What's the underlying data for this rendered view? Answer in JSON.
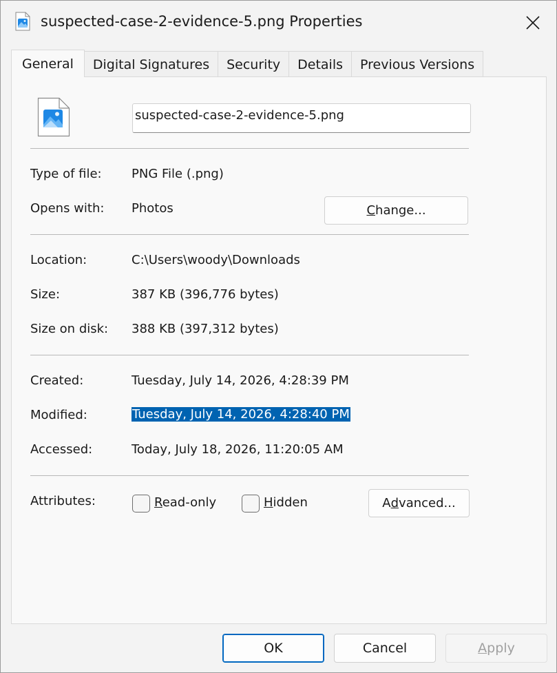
{
  "window": {
    "title": "suspected-case-2-evidence-5.png Properties"
  },
  "tabs": [
    {
      "label": "General",
      "active": true
    },
    {
      "label": "Digital Signatures",
      "active": false
    },
    {
      "label": "Security",
      "active": false
    },
    {
      "label": "Details",
      "active": false
    },
    {
      "label": "Previous Versions",
      "active": false
    }
  ],
  "general": {
    "file_name": "suspected-case-2-evidence-5.png",
    "type_label": "Type of file:",
    "type_value": "PNG File (.png)",
    "opens_label": "Opens with:",
    "opens_value": "Photos",
    "change_button": {
      "pre": "",
      "key": "C",
      "post": "hange..."
    },
    "location_label": "Location:",
    "location_value": "C:\\Users\\woody\\Downloads",
    "size_label": "Size:",
    "size_value": "387 KB (396,776 bytes)",
    "size_disk_label": "Size on disk:",
    "size_disk_value": "388 KB (397,312 bytes)",
    "created_label": "Created:",
    "created_value": "Tuesday, July 14, 2026, 4:28:39 PM",
    "modified_label": "Modified:",
    "modified_value": "Tuesday, July 14, 2026, 4:28:40 PM",
    "accessed_label": "Accessed:",
    "accessed_value": "Today, July 18, 2026, 11:20:05 AM",
    "attributes_label": "Attributes:",
    "readonly": {
      "key": "R",
      "rest": "ead-only",
      "checked": false
    },
    "hidden": {
      "key": "H",
      "rest": "idden",
      "checked": false
    },
    "advanced_button": {
      "pre": "A",
      "key": "d",
      "post": "vanced..."
    }
  },
  "footer": {
    "ok": "OK",
    "cancel": "Cancel",
    "apply_key": "A",
    "apply_rest": "pply"
  },
  "colors": {
    "accent": "#0067c0",
    "selection": "#0063b1"
  }
}
